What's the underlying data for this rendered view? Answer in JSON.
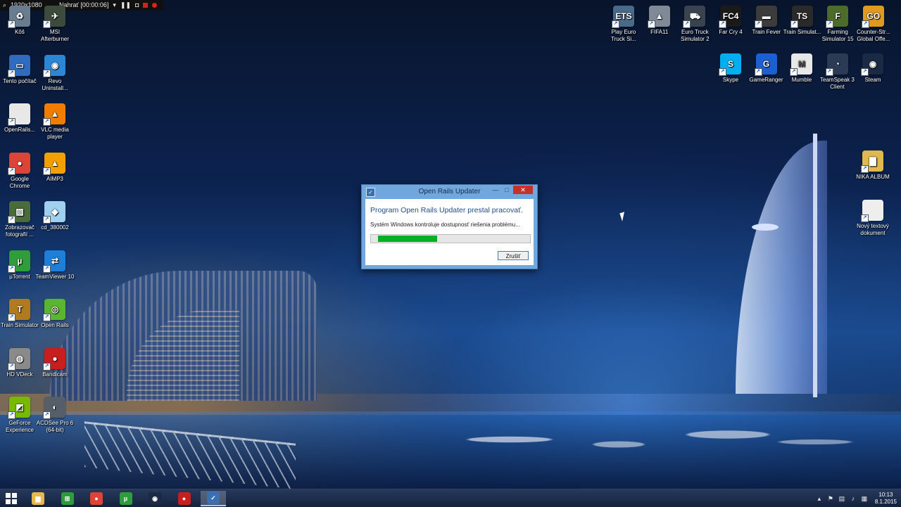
{
  "recorder": {
    "resolution": "1920x1080",
    "status": "Nahrať [00:00:06]"
  },
  "desktop_left": [
    {
      "label": "Kôš",
      "icon": "recycle-bin-icon",
      "color": "#6a7c90",
      "glyph": "♻"
    },
    {
      "label": "MSI Afterburner",
      "icon": "msi-afterburner-icon",
      "color": "#3c4b3c",
      "glyph": "✈"
    },
    {
      "label": "Tento počítač",
      "icon": "computer-icon",
      "color": "#2f6cc0",
      "glyph": "▭"
    },
    {
      "label": "Revo Uninstall...",
      "icon": "revo-uninstaller-icon",
      "color": "#2c86d6",
      "glyph": "◉"
    },
    {
      "label": "OpenRails...",
      "icon": "document-icon",
      "color": "#e8e8e8",
      "glyph": ""
    },
    {
      "label": "VLC media player",
      "icon": "vlc-cone-icon",
      "color": "#f07c00",
      "glyph": "▲"
    },
    {
      "label": "Google Chrome",
      "icon": "chrome-icon",
      "color": "#db4437",
      "glyph": "●"
    },
    {
      "label": "AIMP3",
      "icon": "aimp-icon",
      "color": "#f2a000",
      "glyph": "▲"
    },
    {
      "label": "Zobrazovač fotografií ...",
      "icon": "photo-viewer-icon",
      "color": "#4a6b3a",
      "glyph": "▨"
    },
    {
      "label": "cd_380002",
      "icon": "disc-image-icon",
      "color": "#9fd0ee",
      "glyph": "◆"
    },
    {
      "label": "µTorrent",
      "icon": "utorrent-icon",
      "color": "#2f9e3a",
      "glyph": "µ"
    },
    {
      "label": "TeamViewer 10",
      "icon": "teamviewer-icon",
      "color": "#1f7fd8",
      "glyph": "⇄"
    },
    {
      "label": "Train Simulator",
      "icon": "train-simulator-icon",
      "color": "#b07a1e",
      "glyph": "T"
    },
    {
      "label": "Open Rails",
      "icon": "open-rails-icon",
      "color": "#5ab52f",
      "glyph": "◎"
    },
    {
      "label": "HD VDeck",
      "icon": "hd-vdeck-icon",
      "color": "#8a8a8a",
      "glyph": "◍"
    },
    {
      "label": "Bandicam",
      "icon": "bandicam-icon",
      "color": "#c81e1e",
      "glyph": "●"
    },
    {
      "label": "GeForce Experience",
      "icon": "geforce-icon",
      "color": "#76b900",
      "glyph": "◩"
    },
    {
      "label": "ACDSee Pro 6 (64-bit)",
      "icon": "acdsee-icon",
      "color": "#555f6a",
      "glyph": "◐"
    }
  ],
  "desktop_right_row1": [
    {
      "label": "Play Euro Truck Si...",
      "icon": "euro-truck-icon",
      "color": "#4a6a8a",
      "glyph": "ETS"
    },
    {
      "label": "FIFA11",
      "icon": "fifa-icon",
      "color": "#7f8a96",
      "glyph": "▲"
    },
    {
      "label": "Euro Truck Simulator 2",
      "icon": "euro-truck-2-icon",
      "color": "#3a4450",
      "glyph": "⛟"
    },
    {
      "label": "Far Cry 4",
      "icon": "far-cry-icon",
      "color": "#1a1a1a",
      "glyph": "FC4"
    },
    {
      "label": "Train Fever",
      "icon": "train-fever-icon",
      "color": "#3c3c3c",
      "glyph": "▬"
    },
    {
      "label": "Train Simulat...",
      "icon": "train-sim-ts-icon",
      "color": "#2a2a2a",
      "glyph": "TS"
    },
    {
      "label": "Farming Simulator 15",
      "icon": "farming-simulator-icon",
      "color": "#4d6b2a",
      "glyph": "F"
    },
    {
      "label": "Counter-Str... Global Offe...",
      "icon": "csgo-icon",
      "color": "#e09a20",
      "glyph": "GO"
    }
  ],
  "desktop_right_row2": [
    {
      "label": "Skype",
      "icon": "skype-icon",
      "color": "#00aff0",
      "glyph": "S"
    },
    {
      "label": "GameRanger",
      "icon": "gameranger-icon",
      "color": "#1c5fd0",
      "glyph": "G"
    },
    {
      "label": "Mumble",
      "icon": "mumble-icon",
      "color": "#e8e8e8",
      "glyph": "M"
    },
    {
      "label": "TeamSpeak 3 Client",
      "icon": "teamspeak-icon",
      "color": "#2b3a55",
      "glyph": "◔"
    },
    {
      "label": "Steam",
      "icon": "steam-icon",
      "color": "#1b2a44",
      "glyph": "◉"
    }
  ],
  "desktop_right_col": [
    {
      "label": "NIKA ALBUM",
      "icon": "folder-icon",
      "color": "#e0b850",
      "glyph": "▇"
    },
    {
      "label": "Nový textový dokument",
      "icon": "text-document-icon",
      "color": "#eeeeee",
      "glyph": ""
    }
  ],
  "dialog": {
    "title": "Open Rails Updater",
    "heading": "Program Open Rails Updater prestal pracovať.",
    "message": "Systém Windows kontroluje dostupnosť riešenia problému...",
    "progress_fraction": 0.38,
    "cancel_label": "Zrušiť",
    "minimize_glyph": "—",
    "maximize_glyph": "□",
    "close_glyph": "✕"
  },
  "taskbar": {
    "items": [
      {
        "icon": "file-explorer-icon",
        "color": "#e8b84a",
        "glyph": "▆"
      },
      {
        "icon": "store-icon",
        "color": "#2e9b3a",
        "glyph": "⊞"
      },
      {
        "icon": "chrome-icon",
        "color": "#db4437",
        "glyph": "●"
      },
      {
        "icon": "utorrent-icon",
        "color": "#2f9e3a",
        "glyph": "µ"
      },
      {
        "icon": "steam-icon",
        "color": "#1b2a44",
        "glyph": "◉"
      },
      {
        "icon": "bandicam-icon",
        "color": "#c81e1e",
        "glyph": "●"
      },
      {
        "icon": "open-rails-updater-icon",
        "color": "#3b6fb0",
        "glyph": "✓"
      }
    ],
    "time": "10:13",
    "date": "8.1.2015"
  },
  "colors": {
    "accent_green": "#06b025",
    "dialog_frame": "#6fa7de",
    "close_red": "#c8302c"
  }
}
